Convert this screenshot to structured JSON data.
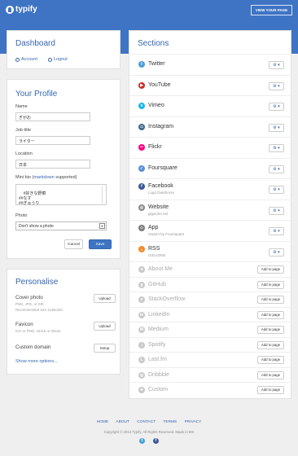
{
  "header": {
    "logo": "typify",
    "view_button": "VIEW YOUR PAGE"
  },
  "dashboard": {
    "title": "Dashboard",
    "account": "Account",
    "logout": "Logout"
  },
  "profile": {
    "title": "Your Profile",
    "name_label": "Name",
    "name_value": "ぎがお",
    "job_label": "Job title",
    "job_value": "ライター",
    "location_label": "Location",
    "location_value": "日本",
    "bio_label_pre": "Mini bio (",
    "bio_label_link": "markdown",
    "bio_label_post": " supported)",
    "bio_value": "#好きな野菜\n##なす\n##ぎゅうり",
    "photo_label": "Photo",
    "photo_value": "Don't show a photo",
    "cancel": "Cancel",
    "save": "Save"
  },
  "personalise": {
    "title": "Personalise",
    "cover_label": "Cover photo",
    "cover_hint1": "PNG, JPG, or GIF.",
    "cover_hint2": "Recommended size 1140x320.",
    "upload1": "Upload",
    "favicon_label": "Favicon",
    "favicon_hint": "ICO or PNG, 16x16 or 32x32.",
    "upload2": "Upload",
    "domain_label": "Custom domain",
    "setup": "Setup",
    "more": "Show more options..."
  },
  "sections": {
    "title": "Sections",
    "active": [
      {
        "name": "Twitter",
        "sub": "",
        "color": "#4a9fd8",
        "glyph": "t"
      },
      {
        "name": "YouTube",
        "sub": "",
        "color": "#c4302b",
        "glyph": "▶"
      },
      {
        "name": "Vimeo",
        "sub": "",
        "color": "#1ab7ea",
        "glyph": "v"
      },
      {
        "name": "Instagram",
        "sub": "",
        "color": "#3f6a8f",
        "glyph": "◘"
      },
      {
        "name": "Flickr",
        "sub": "",
        "color": "#ff0084",
        "glyph": "••"
      },
      {
        "name": "Foursquare",
        "sub": "",
        "color": "#5b8fd6",
        "glyph": "✓"
      },
      {
        "name": "Facebook",
        "sub": "Logo Darkhorse",
        "color": "#3b5998",
        "glyph": "f"
      },
      {
        "name": "Website",
        "sub": "gigazine.net",
        "color": "#888888",
        "glyph": "◎"
      },
      {
        "name": "App",
        "sub": "Swarm by Foursquare",
        "color": "#777777",
        "glyph": "◇"
      },
      {
        "name": "RSS",
        "sub": "GIGAZINE",
        "color": "#f38b2e",
        "glyph": "◟"
      }
    ],
    "inactive": [
      {
        "name": "About Me",
        "glyph": "a"
      },
      {
        "name": "GitHub",
        "glyph": "g"
      },
      {
        "name": "StackOverflow",
        "glyph": "s"
      },
      {
        "name": "LinkedIn",
        "glyph": "in"
      },
      {
        "name": "Medium",
        "glyph": "M"
      },
      {
        "name": "Spotify",
        "glyph": "♫"
      },
      {
        "name": "Last.fm",
        "glyph": "L"
      },
      {
        "name": "Dribbble",
        "glyph": "◎"
      },
      {
        "name": "Custom",
        "glyph": "★"
      }
    ],
    "gear": "⚙ ▾",
    "add": "Add to page"
  },
  "footer": {
    "links": [
      "HOME",
      "ABOUT",
      "CONTACT",
      "TERMS",
      "PRIVACY"
    ],
    "copyright": "Copyright © 2013 Typify. All Rights Reserved. Made in MX",
    "twitter_glyph": "t",
    "facebook_glyph": "f"
  }
}
